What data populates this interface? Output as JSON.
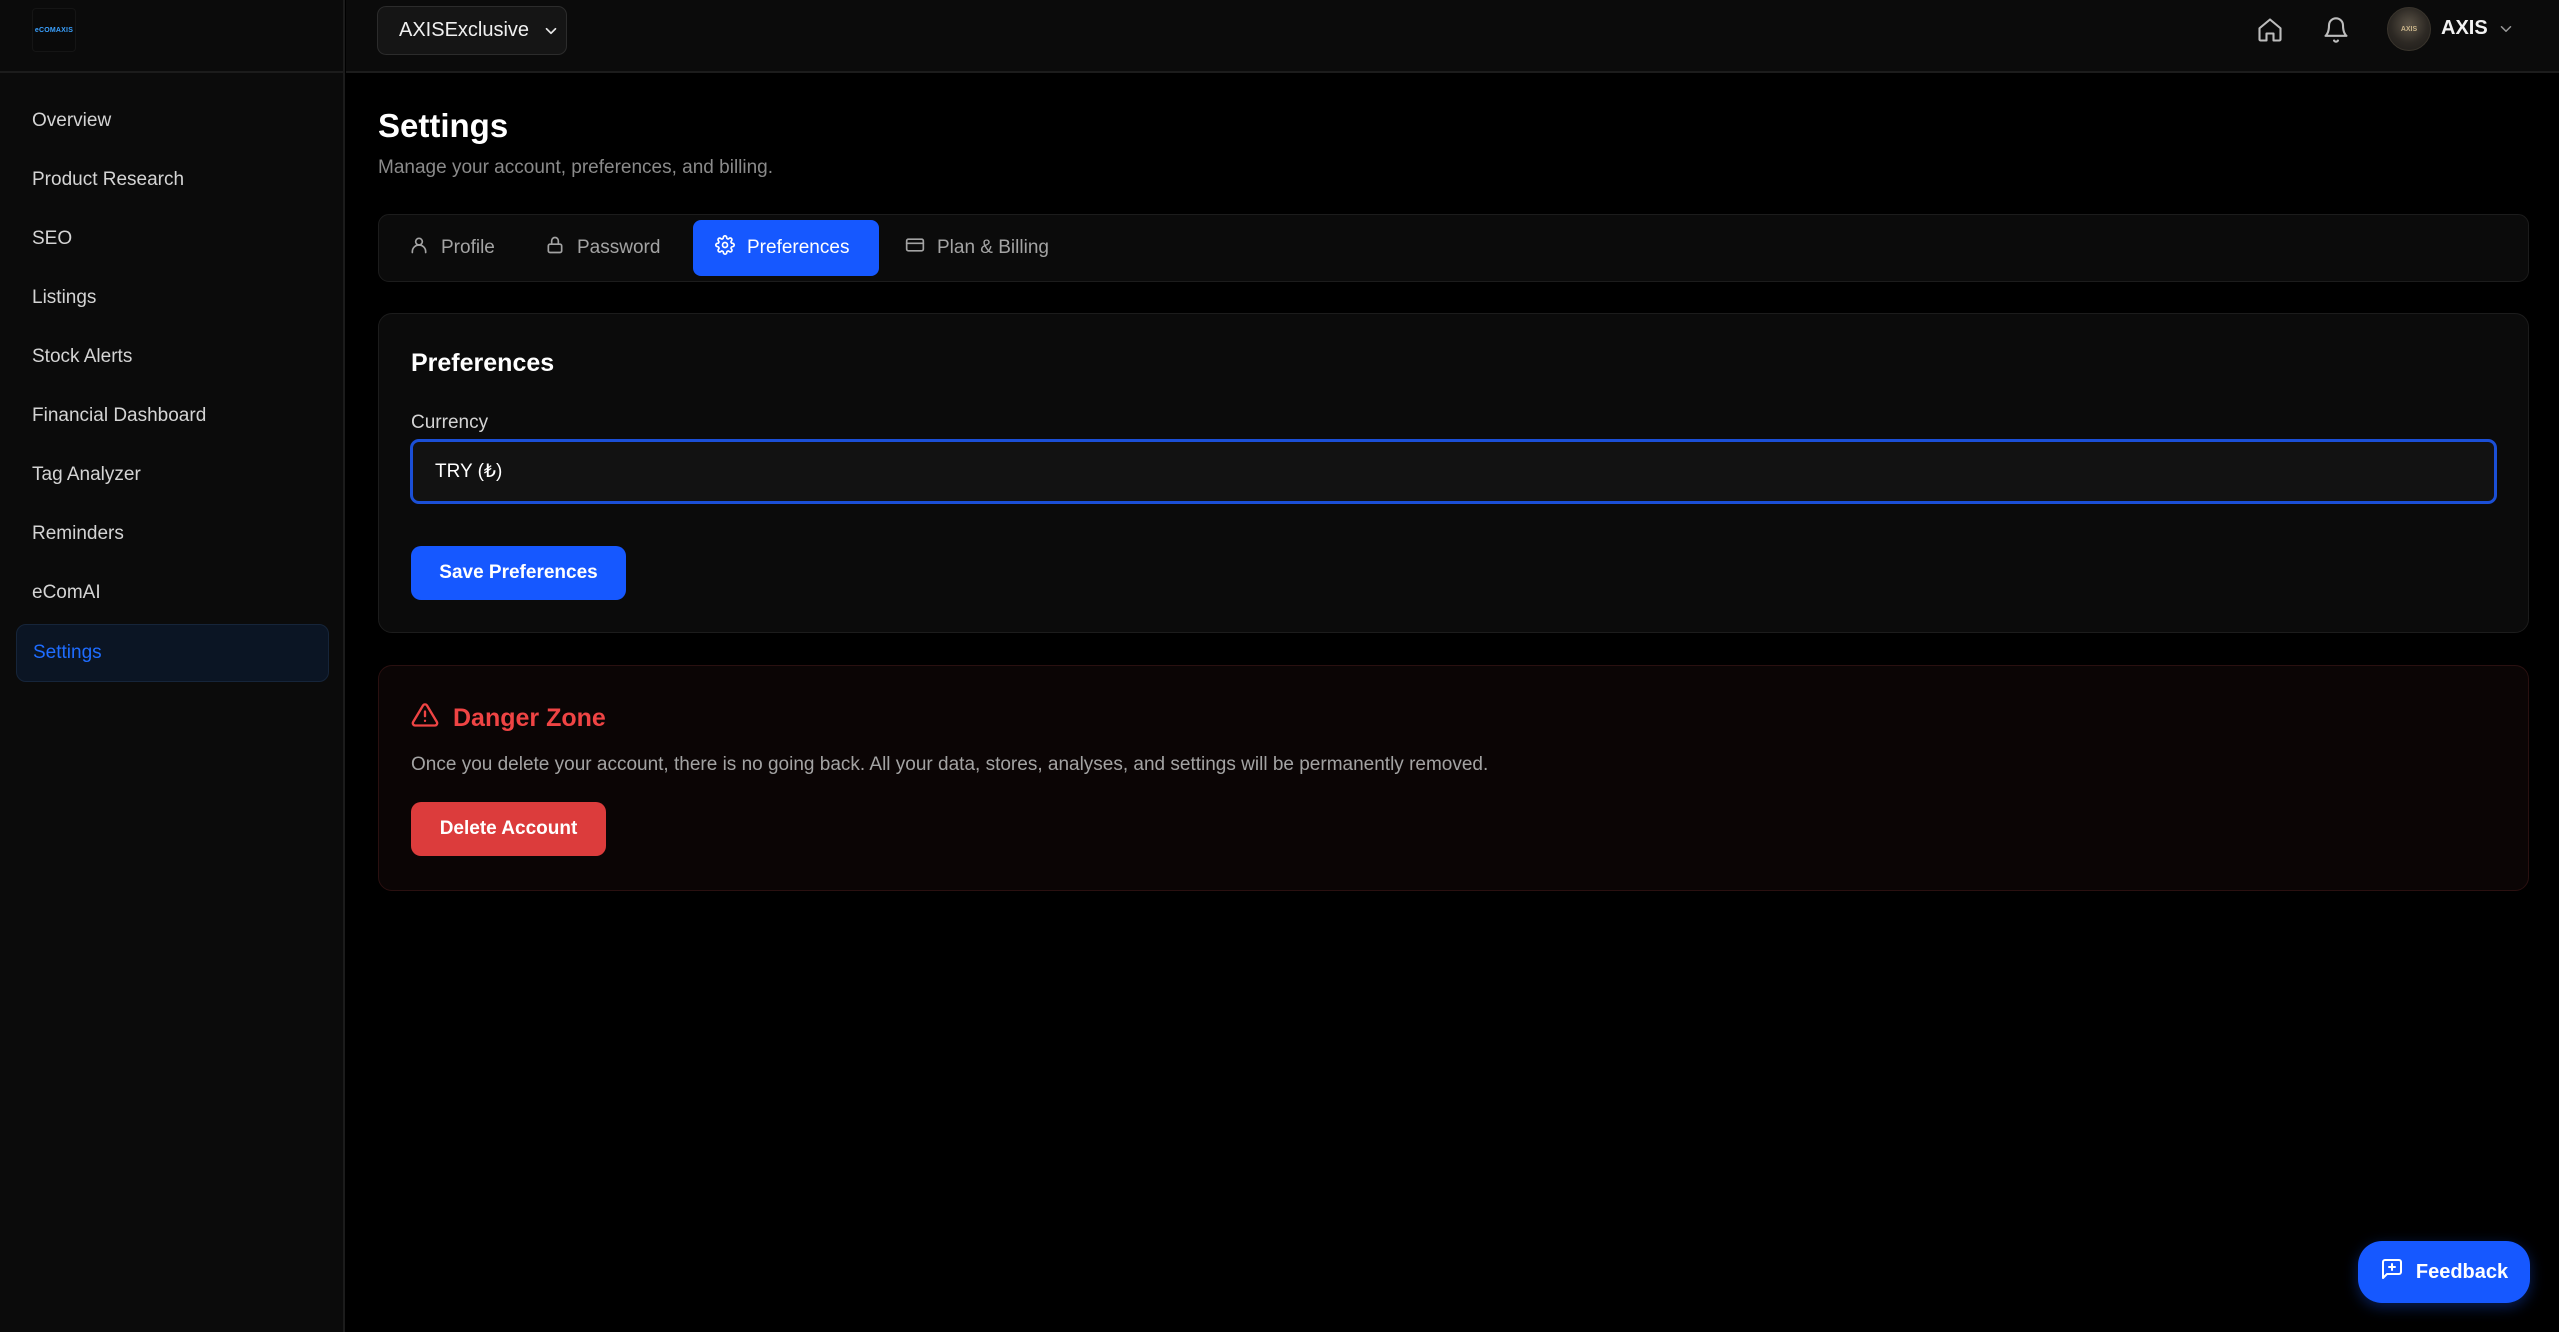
{
  "sidebar": {
    "logo_text": "eCOMAXIS",
    "items": [
      {
        "label": "Overview"
      },
      {
        "label": "Product Research"
      },
      {
        "label": "SEO"
      },
      {
        "label": "Listings"
      },
      {
        "label": "Stock Alerts"
      },
      {
        "label": "Financial Dashboard"
      },
      {
        "label": "Tag Analyzer"
      },
      {
        "label": "Reminders"
      },
      {
        "label": "eComAI"
      },
      {
        "label": "Settings",
        "active": true
      }
    ]
  },
  "header": {
    "store_selector": "AXISExclusive",
    "icons": [
      "home-icon",
      "bell-icon"
    ],
    "user": {
      "name": "AXIS",
      "avatar_text": "AXIS"
    }
  },
  "page": {
    "title": "Settings",
    "subtitle": "Manage your account, preferences, and billing."
  },
  "tabs": [
    {
      "label": "Profile",
      "icon": "user-icon"
    },
    {
      "label": "Password",
      "icon": "lock-icon"
    },
    {
      "label": "Preferences",
      "icon": "gear-icon",
      "active": true
    },
    {
      "label": "Plan & Billing",
      "icon": "credit-card-icon"
    }
  ],
  "preferences": {
    "title": "Preferences",
    "currency_label": "Currency",
    "currency_value": "TRY (₺)",
    "save_label": "Save Preferences"
  },
  "danger_zone": {
    "title": "Danger Zone",
    "description": "Once you delete your account, there is no going back. All your data, stores, analyses, and settings will be permanently removed.",
    "delete_label": "Delete Account"
  },
  "feedback": {
    "label": "Feedback"
  },
  "colors": {
    "accent": "#1658ff",
    "danger": "#ef4444",
    "danger_button": "#dc3c3c",
    "background": "#000000",
    "panel": "#0b0b0b"
  }
}
